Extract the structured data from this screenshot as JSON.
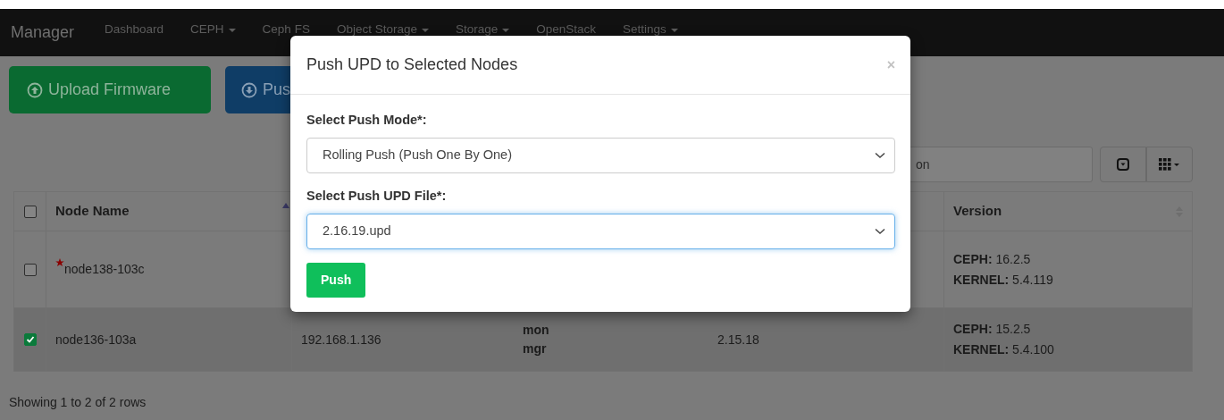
{
  "navbar": {
    "brand": "Manager",
    "items": [
      {
        "label": "Dashboard",
        "dropdown": false
      },
      {
        "label": "CEPH",
        "dropdown": true
      },
      {
        "label": "Ceph FS",
        "dropdown": false
      },
      {
        "label": "Object Storage",
        "dropdown": true
      },
      {
        "label": "Storage",
        "dropdown": true
      },
      {
        "label": "OpenStack",
        "dropdown": false
      },
      {
        "label": "Settings",
        "dropdown": true
      }
    ]
  },
  "actions": [
    {
      "label": "Upload Firmware",
      "kind": "upload"
    },
    {
      "label": "Pus",
      "kind": "download"
    }
  ],
  "search": {
    "placeholder": "on"
  },
  "table": {
    "header_checked": false,
    "columns": [
      {
        "label": "Node Name",
        "sorted": true
      },
      {
        "label": "Version",
        "sorted": false
      }
    ],
    "rows": [
      {
        "selected": false,
        "checked": false,
        "alert": true,
        "name": "node138-103c",
        "versions": [
          {
            "key": "CEPH:",
            "value": "16.2.5"
          },
          {
            "key": "KERNEL:",
            "value": "5.4.119"
          }
        ]
      },
      {
        "selected": true,
        "checked": true,
        "alert": false,
        "name": "node136-103a",
        "ip": "192.168.1.136",
        "roles": [
          "mon",
          "mgr"
        ],
        "firmware": "2.15.18",
        "versions": [
          {
            "key": "CEPH:",
            "value": "15.2.5"
          },
          {
            "key": "KERNEL:",
            "value": "5.4.100"
          }
        ]
      }
    ]
  },
  "footer": "Showing 1 to 2 of 2 rows",
  "modal": {
    "title": "Push UPD to Selected Nodes",
    "close": "×",
    "fields": [
      {
        "label": "Select Push Mode*:",
        "value": "Rolling Push (Push One By One)",
        "focused": false
      },
      {
        "label": "Select Push UPD File*:",
        "value": "2.16.19.upd",
        "focused": true
      }
    ],
    "button": "Push"
  }
}
